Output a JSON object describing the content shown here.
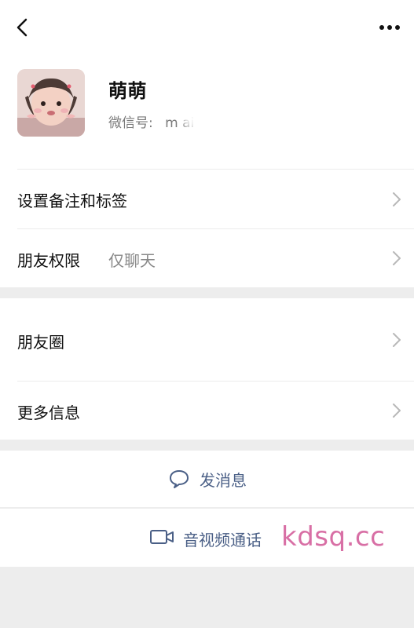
{
  "topbar": {
    "back_icon": "chevron-left-icon",
    "more_icon": "more-horizontal-icon"
  },
  "profile": {
    "name": "萌萌",
    "wechat_id_label": "微信号:",
    "wechat_id_value": "m            ai"
  },
  "menu": [
    {
      "label": "设置备注和标签",
      "secondary": ""
    },
    {
      "label": "朋友权限",
      "secondary": "仅聊天"
    },
    {
      "label": "朋友圈",
      "secondary": ""
    },
    {
      "label": "更多信息",
      "secondary": ""
    }
  ],
  "actions": [
    {
      "label": "发消息",
      "icon": "chat-bubble-icon"
    },
    {
      "label": "音视频通话",
      "icon": "video-camera-icon"
    }
  ],
  "watermark": "kdsq.cc",
  "colors": {
    "background": "#ededed",
    "card": "#ffffff",
    "text": "#111111",
    "secondary": "#888888",
    "action": "#4a5f86",
    "watermark": "#d86fa5"
  }
}
